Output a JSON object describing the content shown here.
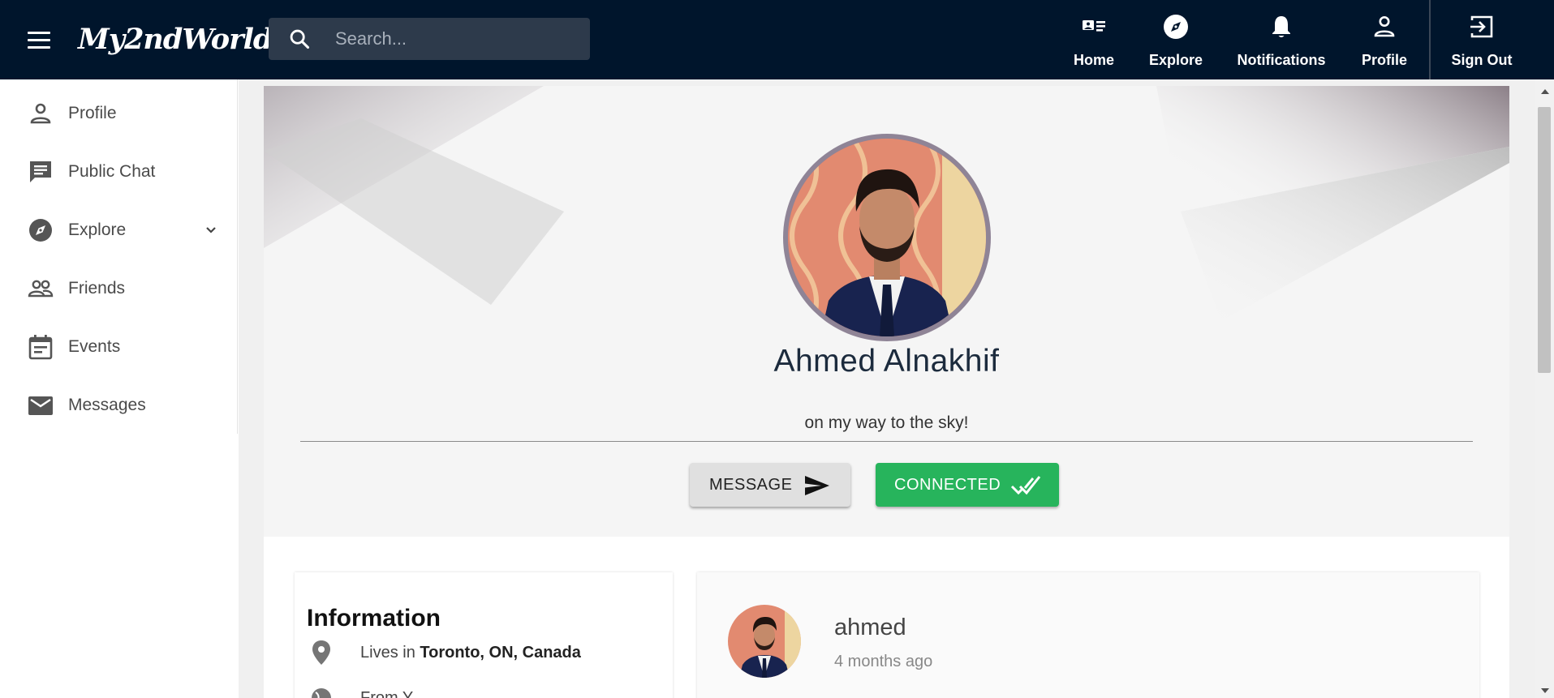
{
  "topbar": {
    "logo": "My2ndWorld",
    "search_placeholder": "Search...",
    "nav": [
      {
        "label": "Home",
        "icon": "home-card-icon"
      },
      {
        "label": "Explore",
        "icon": "compass-icon"
      },
      {
        "label": "Notifications",
        "icon": "bell-icon"
      },
      {
        "label": "Profile",
        "icon": "person-icon"
      },
      {
        "label": "Sign Out",
        "icon": "sign-out-icon"
      }
    ]
  },
  "sidebar": {
    "items": [
      {
        "label": "Profile",
        "icon": "person-outline-icon"
      },
      {
        "label": "Public Chat",
        "icon": "chat-icon"
      },
      {
        "label": "Explore",
        "icon": "compass-icon",
        "expandable": true
      },
      {
        "label": "Friends",
        "icon": "people-icon"
      },
      {
        "label": "Events",
        "icon": "calendar-icon"
      },
      {
        "label": "Messages",
        "icon": "mail-icon"
      }
    ]
  },
  "profile": {
    "name": "Ahmed Alnakhif",
    "status": "on my way to the sky!",
    "message_button": "MESSAGE",
    "connected_button": "CONNECTED"
  },
  "information": {
    "title": "Information",
    "lives_prefix": "Lives in",
    "location": "Toronto, ON, Canada",
    "from_prefix": "From Y..."
  },
  "post": {
    "author": "ahmed",
    "time": "4 months ago"
  },
  "colors": {
    "topbar": "#00152c",
    "search_bg": "#2d3a4b",
    "connected": "#27b45c",
    "avatar_ring": "#8f8496"
  }
}
